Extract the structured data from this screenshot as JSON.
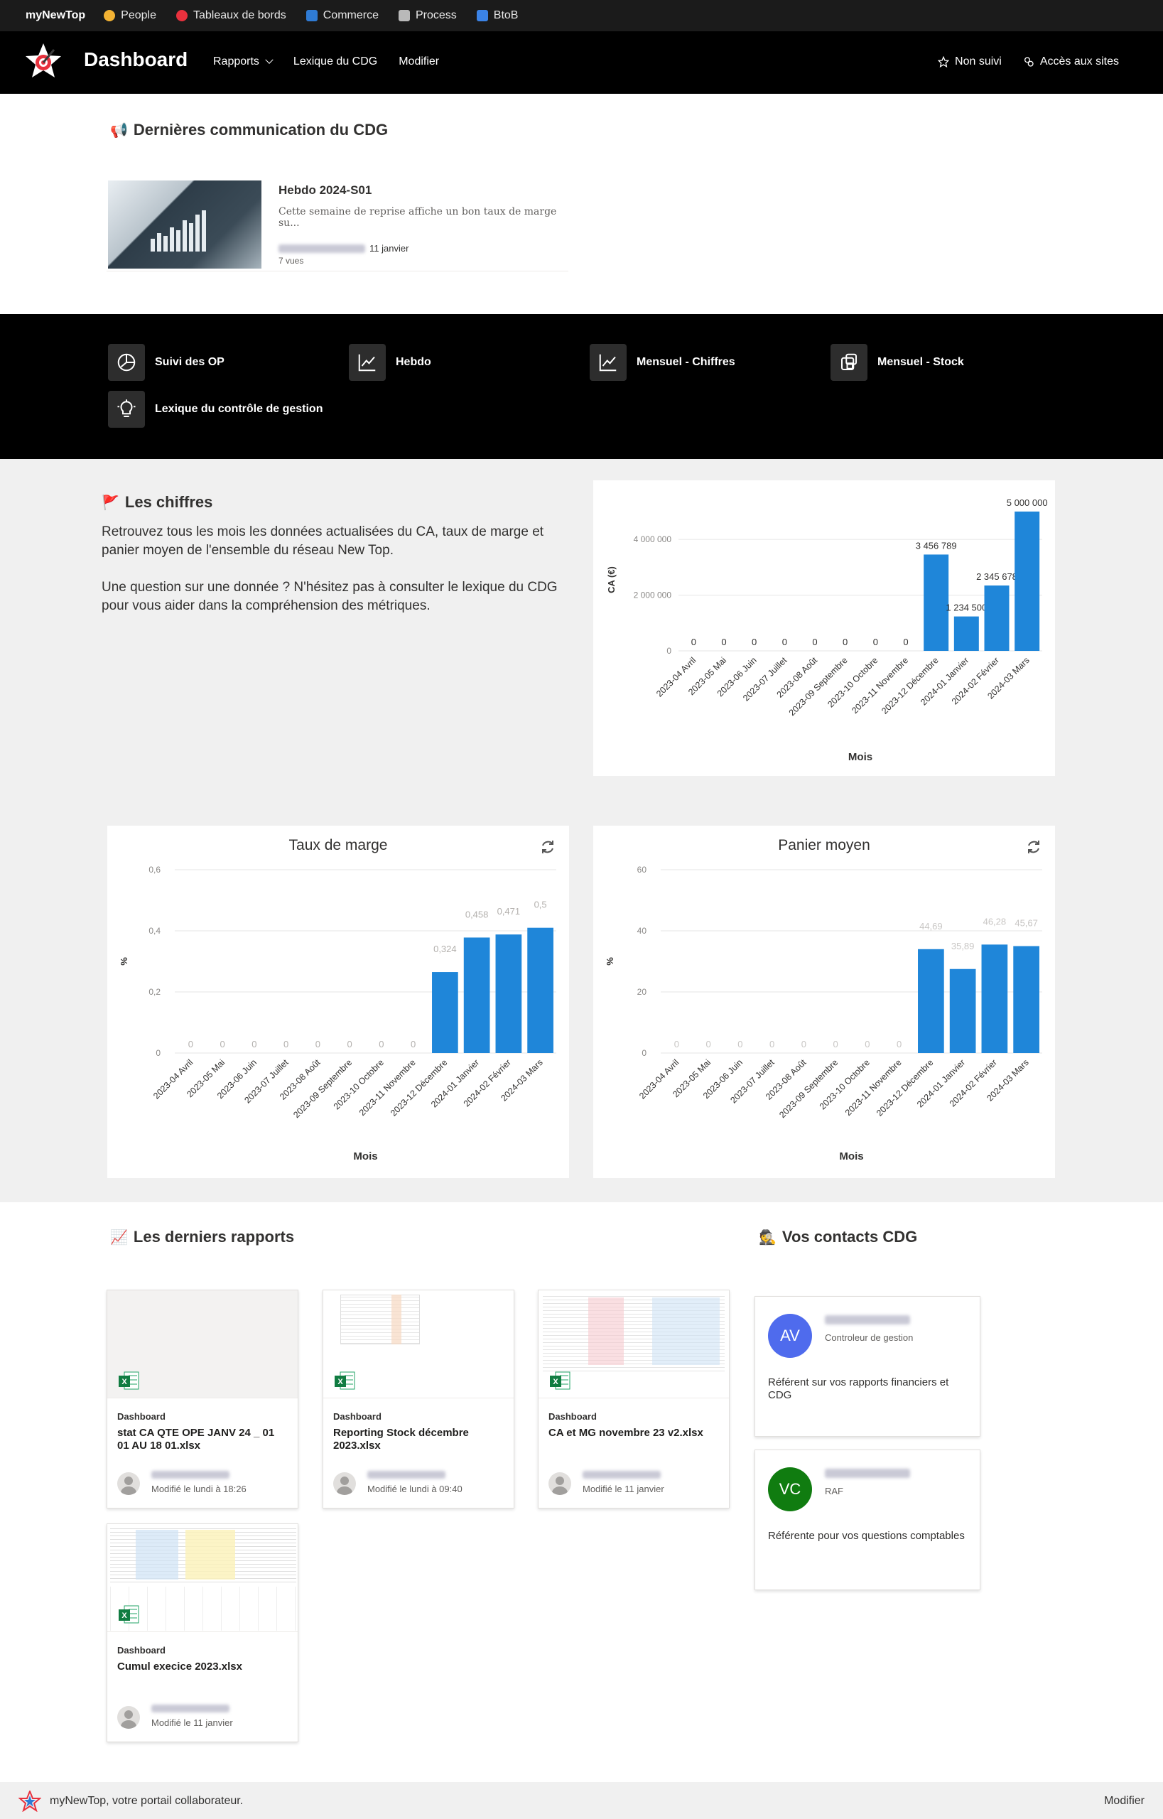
{
  "suitebar": {
    "brand": "myNewTop",
    "links": [
      {
        "label": "People",
        "icon": "people-icon",
        "color": "#f2b233"
      },
      {
        "label": "Tableaux de bords",
        "icon": "target-icon",
        "color": "#e8313d"
      },
      {
        "label": "Commerce",
        "icon": "commerce-icon",
        "color": "#2f7bd4"
      },
      {
        "label": "Process",
        "icon": "process-icon",
        "color": "#b9b9b9"
      },
      {
        "label": "BtoB",
        "icon": "btob-icon",
        "color": "#3b83e6"
      }
    ]
  },
  "header": {
    "title": "Dashboard",
    "nav": [
      {
        "label": "Rapports",
        "has_menu": true
      },
      {
        "label": "Lexique du CDG",
        "has_menu": false
      },
      {
        "label": "Modifier",
        "has_menu": false
      }
    ],
    "follow_label": "Non suivi",
    "access_label": "Accès aux sites"
  },
  "news": {
    "title": "Dernières communication du CDG",
    "item": {
      "title": "Hebdo 2024-S01",
      "description": "Cette semaine de reprise affiche un bon taux de marge su...",
      "date": "11 janvier",
      "views": "7 vues"
    }
  },
  "quicklinks": [
    {
      "label": "Suivi des OP",
      "icon": "pie-chart-icon"
    },
    {
      "label": "Hebdo",
      "icon": "line-chart-icon"
    },
    {
      "label": "Mensuel - Chiffres",
      "icon": "line-chart-icon"
    },
    {
      "label": "Mensuel - Stock",
      "icon": "stock-icon"
    },
    {
      "label": "Lexique du contrôle de gestion",
      "icon": "lightbulb-icon"
    }
  ],
  "chiffres": {
    "title": "Les chiffres",
    "paragraph1": "Retrouvez tous les mois les données actualisées du CA, taux de marge et panier moyen de l'ensemble du réseau New Top.",
    "paragraph2": "Une question sur une donnée ? N'hésitez pas à consulter le lexique du CDG pour vous aider dans la compréhension des métriques."
  },
  "chart_data": [
    {
      "type": "bar",
      "title": "",
      "xlabel": "Mois",
      "ylabel": "CA (€)",
      "categories": [
        "2023-04 Avril",
        "2023-05 Mai",
        "2023-06 Juin",
        "2023-07 Juillet",
        "2023-08 Août",
        "2023-09 Septembre",
        "2023-10 Octobre",
        "2023-11 Novembre",
        "2023-12 Décembre",
        "2024-01 Janvier",
        "2024-02 Février",
        "2024-03 Mars"
      ],
      "values": [
        0,
        0,
        0,
        0,
        0,
        0,
        0,
        0,
        3456789,
        1234500,
        2345678,
        5000000
      ],
      "data_labels": [
        "0",
        "0",
        "0",
        "0",
        "0",
        "0",
        "0",
        "0",
        "3 456 789",
        "1 234 500",
        "2 345 678",
        "5 000 000"
      ],
      "yticks": [
        0,
        2000000,
        4000000
      ],
      "ytick_labels": [
        "0",
        "2 000 000",
        "4 000 000"
      ],
      "ylim": [
        0,
        5100000
      ],
      "grid": true,
      "color": "#1f86d9"
    },
    {
      "type": "bar",
      "title": "Taux de marge",
      "xlabel": "Mois",
      "ylabel": "%",
      "categories": [
        "2023-04 Avril",
        "2023-05 Mai",
        "2023-06 Juin",
        "2023-07 Juillet",
        "2023-08 Août",
        "2023-09 Septembre",
        "2023-10 Octobre",
        "2023-11 Novembre",
        "2023-12 Décembre",
        "2024-01 Janvier",
        "2024-02 Février",
        "2024-03 Mars"
      ],
      "values": [
        0,
        0,
        0,
        0,
        0,
        0,
        0,
        0,
        0.265,
        0.378,
        0.388,
        0.41
      ],
      "data_labels": [
        "0",
        "0",
        "0",
        "0",
        "0",
        "0",
        "0",
        "0",
        "0,324",
        "0,458",
        "0,471",
        "0,5"
      ],
      "yticks": [
        0,
        0.2,
        0.4,
        0.6
      ],
      "ytick_labels": [
        "0",
        "0,2",
        "0,4",
        "0,6"
      ],
      "ylim": [
        0,
        0.6
      ],
      "grid": true,
      "color": "#1f86d9"
    },
    {
      "type": "bar",
      "title": "Panier moyen",
      "xlabel": "Mois",
      "ylabel": "%",
      "categories": [
        "2023-04 Avril",
        "2023-05 Mai",
        "2023-06 Juin",
        "2023-07 Juillet",
        "2023-08 Août",
        "2023-09 Septembre",
        "2023-10 Octobre",
        "2023-11 Novembre",
        "2023-12 Décembre",
        "2024-01 Janvier",
        "2024-02 Février",
        "2024-03 Mars"
      ],
      "values": [
        0,
        0,
        0,
        0,
        0,
        0,
        0,
        0,
        34,
        27.5,
        35.5,
        35
      ],
      "data_labels": [
        "0",
        "0",
        "0",
        "0",
        "0",
        "0",
        "0",
        "0",
        "44,69",
        "35,89",
        "46,28",
        "45,67"
      ],
      "yticks": [
        0,
        20,
        40,
        60
      ],
      "ytick_labels": [
        "0",
        "20",
        "40",
        "60"
      ],
      "ylim": [
        0,
        60
      ],
      "grid": true,
      "color": "#1f86d9"
    }
  ],
  "reports": {
    "title": "Les derniers rapports",
    "items": [
      {
        "site": "Dashboard",
        "name": "stat CA QTE OPE JANV 24 _ 01 01 AU 18 01.xlsx",
        "modified": "Modifié le lundi à 18:26",
        "preview": "blank"
      },
      {
        "site": "Dashboard",
        "name": "Reporting Stock décembre 2023.xlsx",
        "modified": "Modifié le lundi à 09:40",
        "preview": "small"
      },
      {
        "site": "Dashboard",
        "name": "CA et MG novembre 23 v2.xlsx",
        "modified": "Modifié le 11 janvier",
        "preview": "full"
      },
      {
        "site": "Dashboard",
        "name": "Cumul execice 2023.xlsx",
        "modified": "Modifié le 11 janvier",
        "preview": "full2"
      }
    ]
  },
  "contacts": {
    "title": "Vos contacts CDG",
    "items": [
      {
        "initials": "AV",
        "role": "Controleur de gestion",
        "description": "Référent sur vos rapports financiers et CDG",
        "color": "#4f6bed"
      },
      {
        "initials": "VC",
        "role": "RAF",
        "description": "Référente pour vos questions comptables",
        "color": "#107c10"
      }
    ]
  },
  "footer": {
    "text": "myNewTop, votre portail collaborateur.",
    "edit_label": "Modifier"
  }
}
